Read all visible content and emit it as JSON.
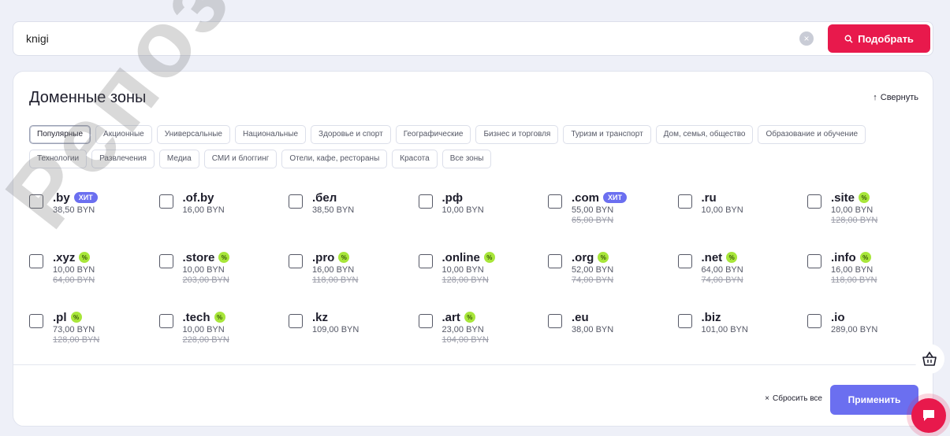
{
  "search": {
    "value": "knigi",
    "clear_icon": "close-icon",
    "submit_label": "Подобрать",
    "submit_icon": "search-icon"
  },
  "colors": {
    "accent_red": "#e8194c",
    "accent_purple": "#6b6ff0",
    "sale_green": "#a8e63a"
  },
  "panel": {
    "title": "Доменные зоны",
    "collapse_label": "Свернуть",
    "collapse_icon": "arrow-up-icon"
  },
  "tags": [
    {
      "label": "Популярные",
      "active": true
    },
    {
      "label": "Акционные",
      "active": false
    },
    {
      "label": "Универсальные",
      "active": false
    },
    {
      "label": "Национальные",
      "active": false
    },
    {
      "label": "Здоровье и спорт",
      "active": false
    },
    {
      "label": "Географические",
      "active": false
    },
    {
      "label": "Бизнес и торговля",
      "active": false
    },
    {
      "label": "Туризм и транспорт",
      "active": false
    },
    {
      "label": "Дом, семья, общество",
      "active": false
    },
    {
      "label": "Образование и обучение",
      "active": false
    },
    {
      "label": "Технологии",
      "active": false
    },
    {
      "label": "Развлечения",
      "active": false
    },
    {
      "label": "Медиа",
      "active": false
    },
    {
      "label": "СМИ и блоггинг",
      "active": false
    },
    {
      "label": "Отели, кафе, рестораны",
      "active": false
    },
    {
      "label": "Красота",
      "active": false
    },
    {
      "label": "Все зоны",
      "active": false
    }
  ],
  "hit_label": "ХИТ",
  "sale_glyph": "%",
  "domains": [
    {
      "name": ".by",
      "badge": "hit",
      "price": "38,50 BYN",
      "old_price": ""
    },
    {
      "name": ".of.by",
      "badge": "",
      "price": "16,00 BYN",
      "old_price": ""
    },
    {
      "name": ".бел",
      "badge": "",
      "price": "38,50 BYN",
      "old_price": ""
    },
    {
      "name": ".рф",
      "badge": "",
      "price": "10,00 BYN",
      "old_price": ""
    },
    {
      "name": ".com",
      "badge": "hit",
      "price": "55,00 BYN",
      "old_price": "65,00 BYN"
    },
    {
      "name": ".ru",
      "badge": "",
      "price": "10,00 BYN",
      "old_price": ""
    },
    {
      "name": ".site",
      "badge": "sale",
      "price": "10,00 BYN",
      "old_price": "128,00 BYN"
    },
    {
      "name": ".xyz",
      "badge": "sale",
      "price": "10,00 BYN",
      "old_price": "64,00 BYN"
    },
    {
      "name": ".store",
      "badge": "sale",
      "price": "10,00 BYN",
      "old_price": "203,00 BYN"
    },
    {
      "name": ".pro",
      "badge": "sale",
      "price": "16,00 BYN",
      "old_price": "118,00 BYN"
    },
    {
      "name": ".online",
      "badge": "sale",
      "price": "10,00 BYN",
      "old_price": "128,00 BYN"
    },
    {
      "name": ".org",
      "badge": "sale",
      "price": "52,00 BYN",
      "old_price": "74,00 BYN"
    },
    {
      "name": ".net",
      "badge": "sale",
      "price": "64,00 BYN",
      "old_price": "74,00 BYN"
    },
    {
      "name": ".info",
      "badge": "sale",
      "price": "16,00 BYN",
      "old_price": "118,00 BYN"
    },
    {
      "name": ".pl",
      "badge": "sale",
      "price": "73,00 BYN",
      "old_price": "128,00 BYN"
    },
    {
      "name": ".tech",
      "badge": "sale",
      "price": "10,00 BYN",
      "old_price": "228,00 BYN"
    },
    {
      "name": ".kz",
      "badge": "",
      "price": "109,00 BYN",
      "old_price": ""
    },
    {
      "name": ".art",
      "badge": "sale",
      "price": "23,00 BYN",
      "old_price": "104,00 BYN"
    },
    {
      "name": ".eu",
      "badge": "",
      "price": "38,00 BYN",
      "old_price": ""
    },
    {
      "name": ".biz",
      "badge": "",
      "price": "101,00 BYN",
      "old_price": ""
    },
    {
      "name": ".io",
      "badge": "",
      "price": "289,00 BYN",
      "old_price": ""
    }
  ],
  "footer": {
    "reset_label": "Сбросить все",
    "reset_icon": "close-icon",
    "apply_label": "Применить"
  },
  "floating": {
    "cart_icon": "basket-icon",
    "chat_icon": "chat-icon"
  },
  "watermark": "Репозиторий"
}
